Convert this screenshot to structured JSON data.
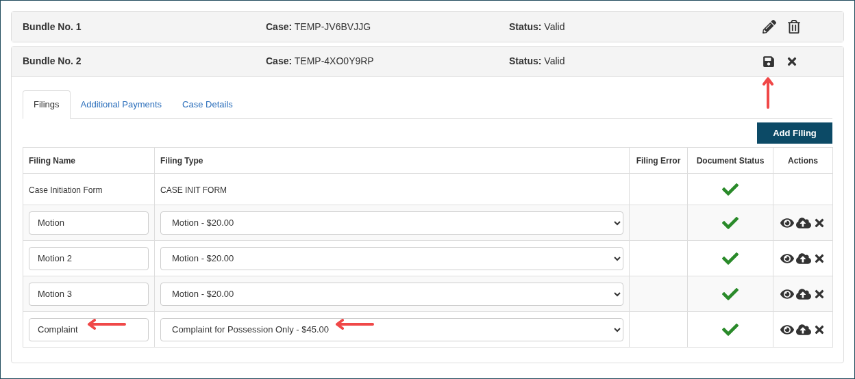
{
  "bundles": [
    {
      "title": "Bundle No. 1",
      "case_label": "Case:",
      "case": "TEMP-JV6BVJJG",
      "status_label": "Status:",
      "status": "Valid",
      "editing": false,
      "annotated": false
    },
    {
      "title": "Bundle No. 2",
      "case_label": "Case:",
      "case": "TEMP-4XO0Y9RP",
      "status_label": "Status:",
      "status": "Valid",
      "editing": true,
      "annotated": true
    }
  ],
  "tabs": [
    {
      "label": "Filings",
      "selected": true
    },
    {
      "label": "Additional Payments",
      "selected": false
    },
    {
      "label": "Case Details",
      "selected": false
    }
  ],
  "add_button": "Add Filing",
  "table": {
    "columns": [
      "Filing Name",
      "Filing Type",
      "Filing Error",
      "Document Status",
      "Actions"
    ],
    "rows": [
      {
        "kind": "fixed",
        "name": "Case Initiation Form",
        "type": "CASE INIT FORM",
        "document_ok": true,
        "annotated": false
      },
      {
        "kind": "editable",
        "name": "Motion",
        "type": "Motion - $20.00",
        "document_ok": true,
        "annotated": false
      },
      {
        "kind": "editable",
        "name": "Motion 2",
        "type": "Motion - $20.00",
        "document_ok": true,
        "annotated": false
      },
      {
        "kind": "editable",
        "name": "Motion 3",
        "type": "Motion - $20.00",
        "document_ok": true,
        "annotated": false
      },
      {
        "kind": "editable",
        "name": "Complaint",
        "type": "Complaint for Possession Only - $45.00",
        "document_ok": true,
        "annotated": true
      }
    ]
  }
}
